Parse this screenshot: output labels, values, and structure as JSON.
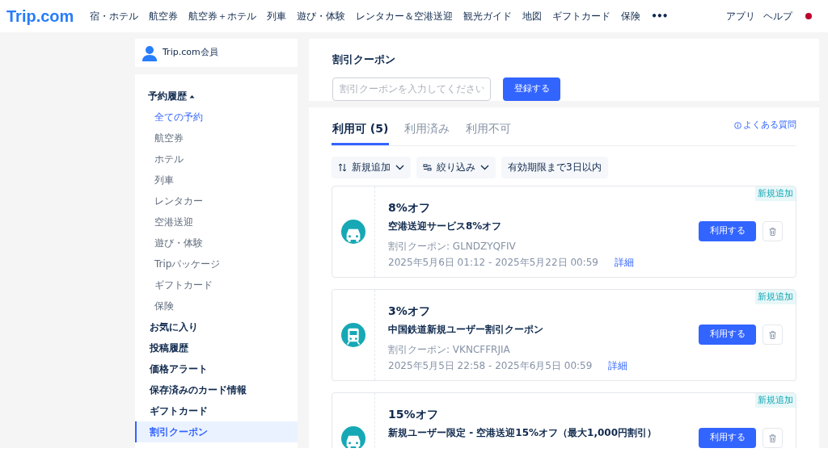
{
  "header": {
    "logo": "Trip.com",
    "nav": [
      "宿・ホテル",
      "航空券",
      "航空券＋ホテル",
      "列車",
      "遊び・体験",
      "レンタカー＆空港送迎",
      "観光ガイド",
      "地図",
      "ギフトカード",
      "保険"
    ],
    "more": "•••",
    "links": [
      "アプリ",
      "ヘルプ"
    ]
  },
  "sidebar": {
    "member": "Trip.com会員",
    "section": {
      "label": "予約履歴",
      "expanded": true,
      "children": [
        {
          "label": "全ての予約",
          "selected": true
        },
        {
          "label": "航空券",
          "selected": false
        },
        {
          "label": "ホテル",
          "selected": false
        },
        {
          "label": "列車",
          "selected": false
        },
        {
          "label": "レンタカー",
          "selected": false
        },
        {
          "label": "空港送迎",
          "selected": false
        },
        {
          "label": "遊び・体験",
          "selected": false
        },
        {
          "label": "Tripパッケージ",
          "selected": false
        },
        {
          "label": "ギフトカード",
          "selected": false
        },
        {
          "label": "保険",
          "selected": false
        }
      ]
    },
    "items": [
      {
        "label": "お気に入り",
        "selected": false
      },
      {
        "label": "投稿履歴",
        "selected": false
      },
      {
        "label": "価格アラート",
        "selected": false
      },
      {
        "label": "保存済みのカード情報",
        "selected": false
      },
      {
        "label": "ギフトカード",
        "selected": false
      },
      {
        "label": "割引クーポン",
        "selected": true
      }
    ]
  },
  "coupon_entry": {
    "title": "割引クーポン",
    "placeholder": "割引クーポンを入力してください",
    "button": "登録する"
  },
  "tabs": [
    {
      "label": "利用可 (5)",
      "selected": true
    },
    {
      "label": "利用済み",
      "selected": false
    },
    {
      "label": "利用不可",
      "selected": false
    }
  ],
  "faq_link": "よくある質問",
  "filters": [
    {
      "label": "新規追加",
      "kind": "sort"
    },
    {
      "label": "絞り込み",
      "kind": "filter"
    },
    {
      "label": "有効期限まで3日以内",
      "kind": "plain"
    }
  ],
  "coupons": [
    {
      "kind": "car",
      "discount": "8%オフ",
      "name": "空港送迎サービス8%オフ",
      "code": "割引クーポン: GLNDZYQFIV",
      "period": "2025年5月6日 01:12 - 2025年5月22日 00:59",
      "details": "詳細",
      "badge": "新規追加",
      "button": "利用する"
    },
    {
      "kind": "train",
      "discount": "3%オフ",
      "name": "中国鉄道新規ユーザー割引クーポン",
      "code": "割引クーポン: VKNCFFRJIA",
      "period": "2025年5月5日 22:58 - 2025年6月5日 00:59",
      "details": "詳細",
      "badge": "新規追加",
      "button": "利用する"
    },
    {
      "kind": "car",
      "discount": "15%オフ",
      "name": "新規ユーザー限定 - 空港送迎15%オフ（最大1,000円割引）",
      "badge": "新規追加",
      "button": "利用する"
    }
  ]
}
